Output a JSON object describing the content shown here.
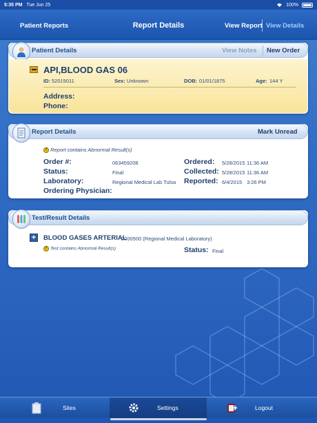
{
  "status_bar": {
    "time": "5:35 PM",
    "date": "Tue Jun 25",
    "battery": "100%"
  },
  "nav": {
    "back_label": "Patient Reports",
    "title": "Report Details",
    "seg_view_report": "View Report",
    "seg_view_details": "View Details"
  },
  "patient_card": {
    "header": "Patient Details",
    "view_notes": "View Notes",
    "new_order": "New Order",
    "name": "API,BLOOD GAS 06",
    "id_label": "ID:",
    "id_value": "52015011",
    "sex_label": "Sex:",
    "sex_value": "Unknown",
    "dob_label": "DOB:",
    "dob_value": "01/01/1875",
    "age_label": "Age:",
    "age_value": "144 Y",
    "address_label": "Address:",
    "phone_label": "Phone:"
  },
  "report_card": {
    "header": "Report Details",
    "mark_unread": "Mark Unread",
    "abnormal_note": "Report contains Abnormal Result(s)",
    "order_label": "Order #:",
    "order_value": "063459208",
    "status_label": "Status:",
    "status_value": "Final",
    "lab_label": "Laboratory:",
    "lab_value": "Regional Medical Lab Tulsa",
    "physician_label": "Ordering Physician:",
    "ordered_label": "Ordered:",
    "ordered_date": "5/28/2015",
    "ordered_time": "11:36 AM",
    "collected_label": "Collected:",
    "collected_date": "5/28/2015",
    "collected_time": "11:36 AM",
    "reported_label": "Reported:",
    "reported_date": "6/4/2015",
    "reported_time": "3:26 PM"
  },
  "test_card": {
    "header": "Test/Result Details",
    "test_name": "BLOOD GASES ARTERIAL",
    "test_code": "2000500 (Regional Medical Laboratory)",
    "abnormal_note": "Test contains Abnormal Result(s)",
    "status_label": "Status:",
    "status_value": "Final"
  },
  "tabs": [
    {
      "label": "Sites",
      "icon": "sites-icon"
    },
    {
      "label": "Settings",
      "icon": "gear-icon"
    },
    {
      "label": "Logout",
      "icon": "logout-icon"
    }
  ],
  "colors": {
    "accent": "#1f56b2",
    "highlight": "#fbeaa6",
    "selected_segment": "#9fd0ff"
  }
}
